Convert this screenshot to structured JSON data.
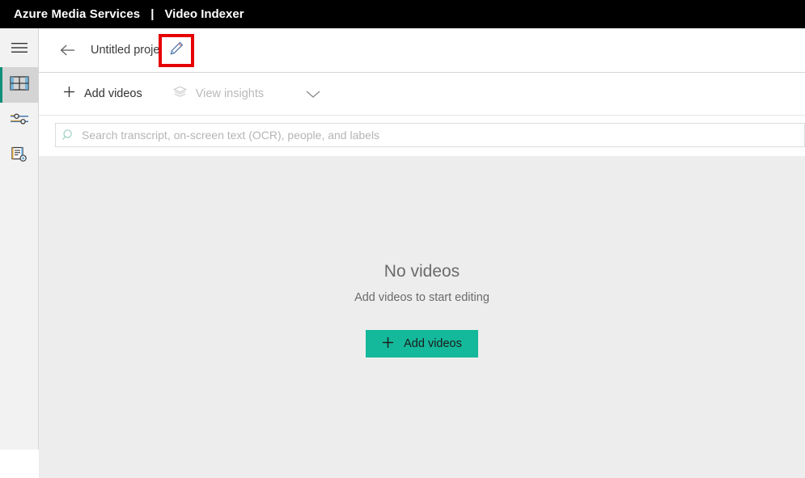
{
  "topbar": {
    "brand": "Azure Media Services",
    "separator": "|",
    "product": "Video Indexer"
  },
  "rail": {
    "items": [
      {
        "id": "menu",
        "icon": "hamburger-menu-icon",
        "selected": false
      },
      {
        "id": "media",
        "icon": "film-strip-icon",
        "selected": true
      },
      {
        "id": "settings",
        "icon": "sliders-icon",
        "selected": false
      },
      {
        "id": "model-customization",
        "icon": "document-gear-icon",
        "selected": false
      }
    ]
  },
  "title_row": {
    "back_icon": "back-arrow-icon",
    "project_name": "Untitled project",
    "edit_icon": "pencil-edit-icon",
    "highlight_color": "#e60000"
  },
  "toolbar": {
    "add_videos": {
      "label": "Add videos",
      "icon": "plus-icon",
      "disabled": false
    },
    "view_insights": {
      "label": "View insights",
      "icon": "layers-icon",
      "disabled": true
    },
    "chevron": "chevron-down-icon"
  },
  "search": {
    "icon": "search-icon",
    "value": "",
    "placeholder": "Search transcript, on-screen text (OCR), people, and labels"
  },
  "empty_state": {
    "title": "No videos",
    "subtitle": "Add videos to start editing",
    "button_label": "Add videos",
    "button_icon": "plus-icon",
    "button_color": "#14b89a"
  }
}
